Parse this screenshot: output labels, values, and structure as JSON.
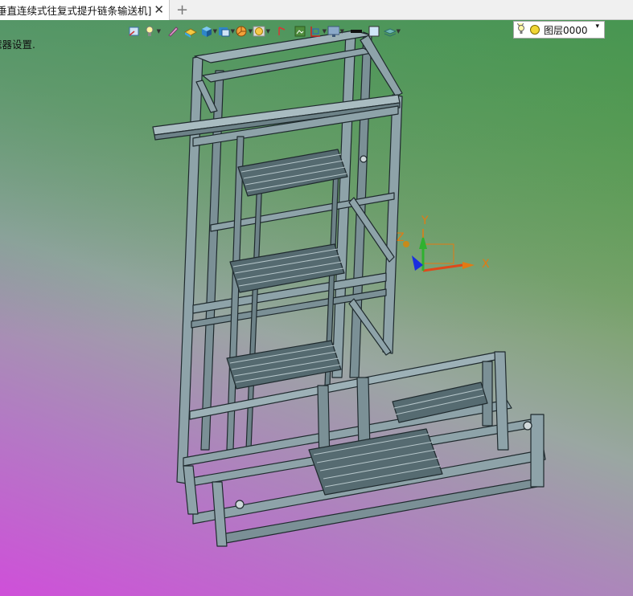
{
  "tab": {
    "title": "垂直连续式往复式提升链条输送机]",
    "close_glyph": "✕",
    "new_glyph": "+"
  },
  "command_line": {
    "text": "滤器设置."
  },
  "toolbar": {
    "layer_name": "图层0000",
    "dropdown_glyph": "▾"
  },
  "ucs": {
    "x_label": "X",
    "y_label": "Y",
    "z_label": "Z",
    "x_color": "#e0481a",
    "y_color": "#2fb12f",
    "z_color": "#1a2ee0",
    "label_color": "#e27a13"
  },
  "colors": {
    "frame": "#8ea3a9",
    "frame_dark": "#2a3438",
    "gradient_top_right": "#56a22f",
    "gradient_bottom_left": "#cf4fd9"
  }
}
